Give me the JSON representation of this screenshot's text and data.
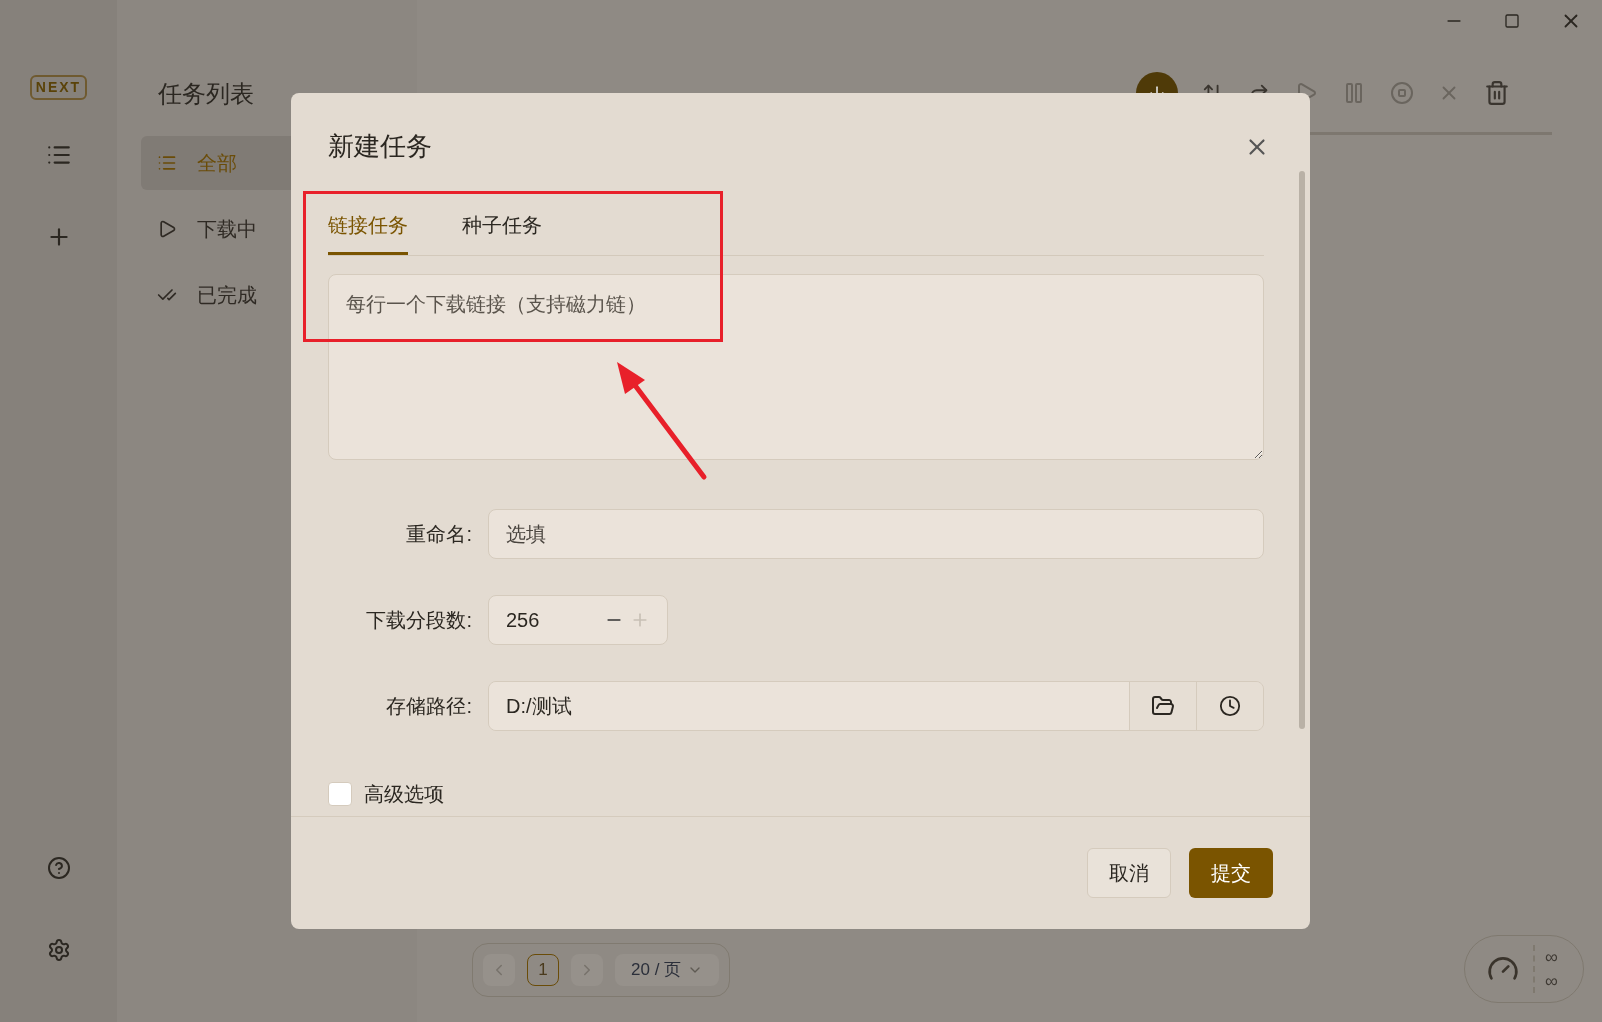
{
  "brand": "NEXT",
  "sidebar": {
    "title": "任务列表",
    "items": [
      {
        "label": "全部",
        "selected": true
      },
      {
        "label": "下载中",
        "selected": false
      },
      {
        "label": "已完成",
        "selected": false
      }
    ]
  },
  "dialog": {
    "title": "新建任务",
    "tabs": [
      {
        "label": "链接任务",
        "selected": true
      },
      {
        "label": "种子任务",
        "selected": false
      }
    ],
    "links": {
      "placeholder": "每行一个下载链接（支持磁力链）"
    },
    "rename": {
      "label": "重命名:",
      "placeholder": "选填"
    },
    "segments": {
      "label": "下载分段数:",
      "value": "256"
    },
    "path": {
      "label": "存储路径:",
      "value": "D:/测试"
    },
    "advanced": {
      "label": "高级选项",
      "checked": false
    },
    "buttons": [
      {
        "label": "取消",
        "kind": "secondary"
      },
      {
        "label": "提交",
        "kind": "primary"
      }
    ]
  },
  "pagination": {
    "pages": [
      {
        "label": "1",
        "selected": true
      }
    ],
    "page_size": "20 / 页"
  },
  "speed": {
    "upload": "∞",
    "download": "∞"
  }
}
